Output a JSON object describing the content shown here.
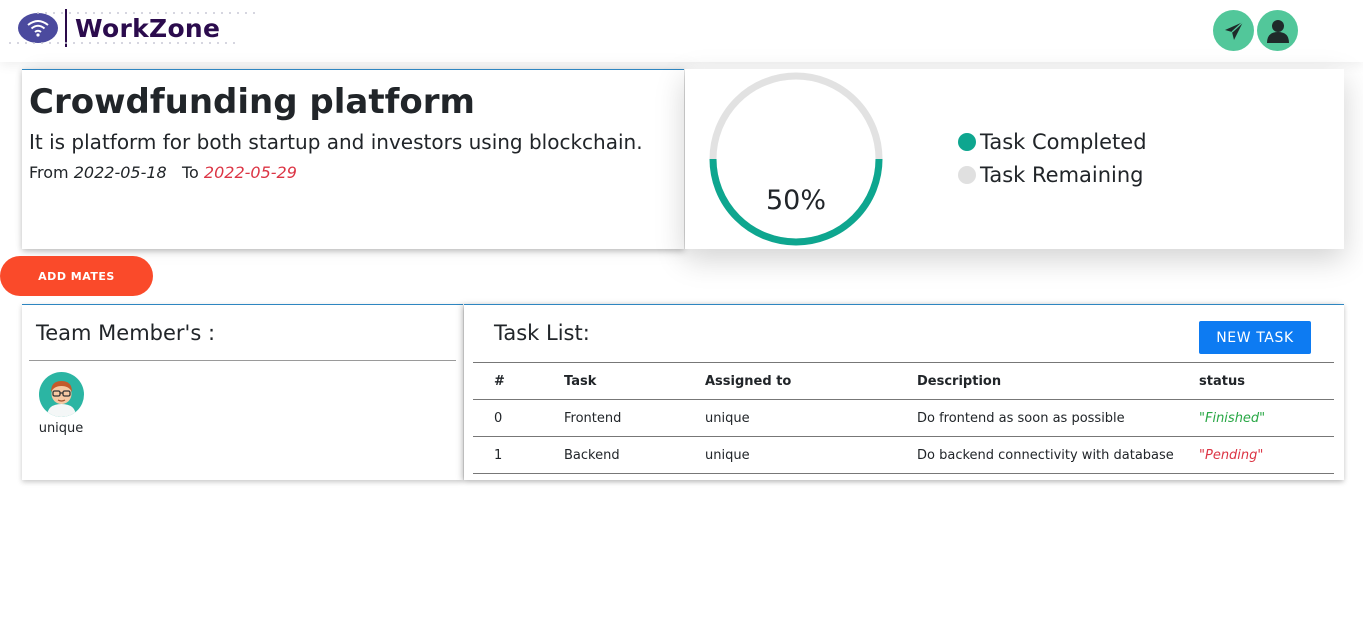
{
  "header": {
    "brand": "WorkZone",
    "icons": {
      "send": "paper-plane-icon",
      "profile": "user-icon",
      "logo": "wifi-icon"
    }
  },
  "project": {
    "title": "Crowdfunding platform",
    "description": "It is platform for both startup and investors using blockchain.",
    "from_label": "From",
    "from_date": "2022-05-18",
    "to_label": "To",
    "to_date": "2022-05-29"
  },
  "progress": {
    "percent_value": 50,
    "percent_label": "50%",
    "legend": [
      {
        "label": "Task Completed",
        "color": "#0ea68f"
      },
      {
        "label": "Task Remaining",
        "color": "#e0e0e0"
      }
    ]
  },
  "actions": {
    "add_mates": "ADD MATES"
  },
  "team": {
    "title": "Team Member's :",
    "members": [
      {
        "name": "unique"
      }
    ]
  },
  "tasks": {
    "title": "Task List:",
    "new_task": "NEW TASK",
    "columns": [
      "#",
      "Task",
      "Assigned to",
      "Description",
      "status"
    ],
    "rows": [
      {
        "num": "0",
        "task": "Frontend",
        "assigned": "unique",
        "description": "Do frontend as soon as possible",
        "status": "\"Finished\""
      },
      {
        "num": "1",
        "task": "Backend",
        "assigned": "unique",
        "description": "Do backend connectivity with database",
        "status": "\"Pending\""
      }
    ]
  },
  "colors": {
    "accent": "#0d7bf2",
    "add_mates": "#fa4a2a",
    "header_buttons": "#52c79a",
    "completed": "#0ea68f"
  }
}
